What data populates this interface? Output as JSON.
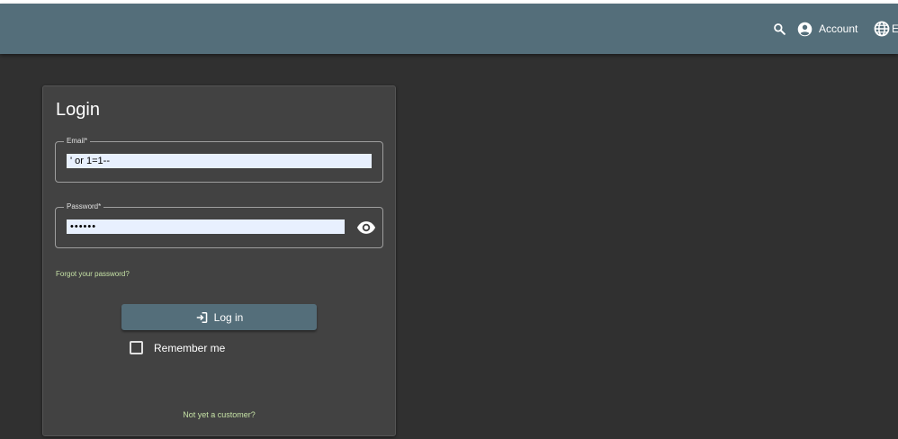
{
  "toolbar": {
    "search_icon": "search-icon",
    "account_label": "Account",
    "account_icon": "account-circle-icon",
    "language_label": "E",
    "language_icon": "globe-icon"
  },
  "login": {
    "title": "Login",
    "email": {
      "label": "Email*",
      "value": "' or 1=1--"
    },
    "password": {
      "label": "Password*",
      "value": "••••••",
      "toggle_icon": "eye-icon"
    },
    "forgot_password": "Forgot your password?",
    "login_button": "Log in",
    "login_icon": "login-icon",
    "remember_me": "Remember me",
    "register_link": "Not yet a customer?"
  },
  "colors": {
    "toolbar": "#546e7a",
    "background": "#303030",
    "card": "#424242",
    "link": "#c5e1a5",
    "autofill": "#e8f0fe"
  }
}
